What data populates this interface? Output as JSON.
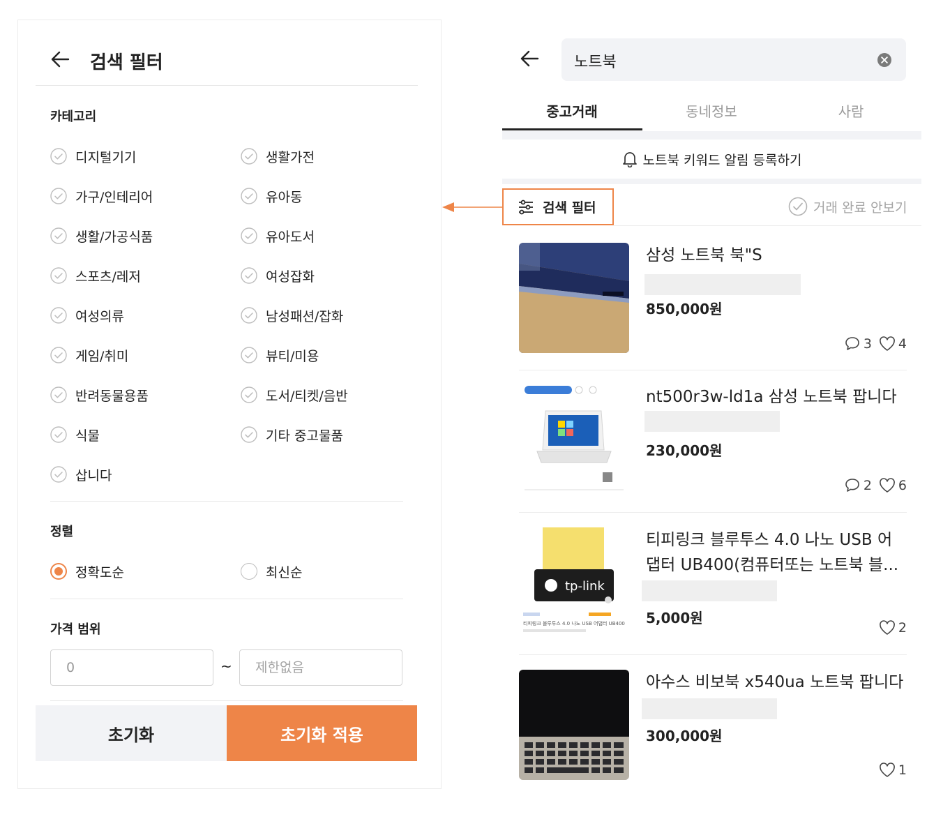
{
  "filter_panel": {
    "title": "검색 필터",
    "category_section": "카테고리",
    "categories_left": [
      "디지털기기",
      "가구/인테리어",
      "생활/가공식품",
      "스포츠/레저",
      "여성의류",
      "게임/취미",
      "반려동물용품",
      "식물",
      "삽니다"
    ],
    "categories_right": [
      "생활가전",
      "유아동",
      "유아도서",
      "여성잡화",
      "남성패션/잡화",
      "뷰티/미용",
      "도서/티켓/음반",
      "기타 중고물품"
    ],
    "sort_section": "정렬",
    "sort_options": [
      "정확도순",
      "최신순"
    ],
    "sort_selected": "정확도순",
    "price_section": "가격 범위",
    "price_min": "0",
    "price_max_placeholder": "제한없음",
    "price_separator": "~",
    "reset_label": "초기화",
    "apply_label": "초기화 적용",
    "accent_color": "#ee8548"
  },
  "results": {
    "query": "노트북",
    "tabs": [
      "중고거래",
      "동네정보",
      "사람"
    ],
    "active_tab": "중고거래",
    "keyword_alert": "노트북 키워드 알림 등록하기",
    "filter_button": "검색 필터",
    "hide_completed": "거래 완료 안보기",
    "items": [
      {
        "title": "삼성 노트북 북\"S",
        "price": "850,000원",
        "comments": "3",
        "likes": "4"
      },
      {
        "title": "nt500r3w-ld1a 삼성 노트북 팝니다",
        "price": "230,000원",
        "comments": "2",
        "likes": "6"
      },
      {
        "title": "티피링크 블루투스 4.0 나노 USB 어댑터 UB400(컴퓨터또는 노트북 블...",
        "price": "5,000원",
        "comments": "",
        "likes": "2"
      },
      {
        "title": "아수스 비보북 x540ua 노트북 팝니다",
        "price": "300,000원",
        "comments": "",
        "likes": "1"
      }
    ],
    "thumb_texts": {
      "tplink_logo": "tp-link",
      "tplink_caption": "티피링크 블루투스 4.0 나노 USB 어댑터 UB400"
    }
  }
}
